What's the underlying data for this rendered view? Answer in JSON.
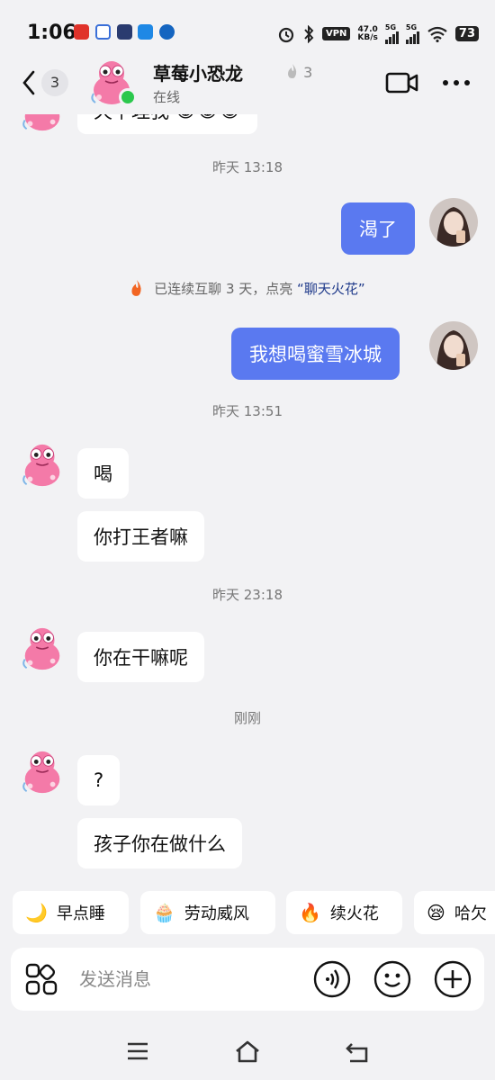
{
  "status_bar": {
    "time": "1:06",
    "net_speed_value": "47.0",
    "net_speed_unit": "KB/s",
    "vpn": "VPN",
    "net_type_1": "5G",
    "net_type_2": "5G",
    "battery": "73"
  },
  "header": {
    "back_count": "3",
    "contact_name": "草莓小恐龙",
    "fire_level": "3",
    "status": "在线"
  },
  "messages": {
    "partial_text": "天下理我",
    "ts1": "昨天 13:18",
    "out1": "渴了",
    "streak_prefix": "已连续互聊 3 天，点亮",
    "streak_link": "“聊天火花”",
    "out2": "我想喝蜜雪冰城",
    "ts2": "昨天 13:51",
    "in1": "喝",
    "in2": "你打王者嘛",
    "ts3": "昨天 23:18",
    "in3": "你在干嘛呢",
    "ts4": "刚刚",
    "in4": "?",
    "in5": "孩子你在做什么"
  },
  "quick_replies": [
    {
      "emoji": "🌙",
      "label": "早点睡"
    },
    {
      "emoji": "🧁",
      "label": "劳动威风"
    },
    {
      "emoji": "🔥",
      "label": "续火花"
    },
    {
      "emoji": "😪",
      "label": "哈欠"
    }
  ],
  "input": {
    "placeholder": "发送消息"
  },
  "colors": {
    "bubble_out": "#5a79f0",
    "background": "#f2f2f4",
    "online": "#2cc84d"
  }
}
